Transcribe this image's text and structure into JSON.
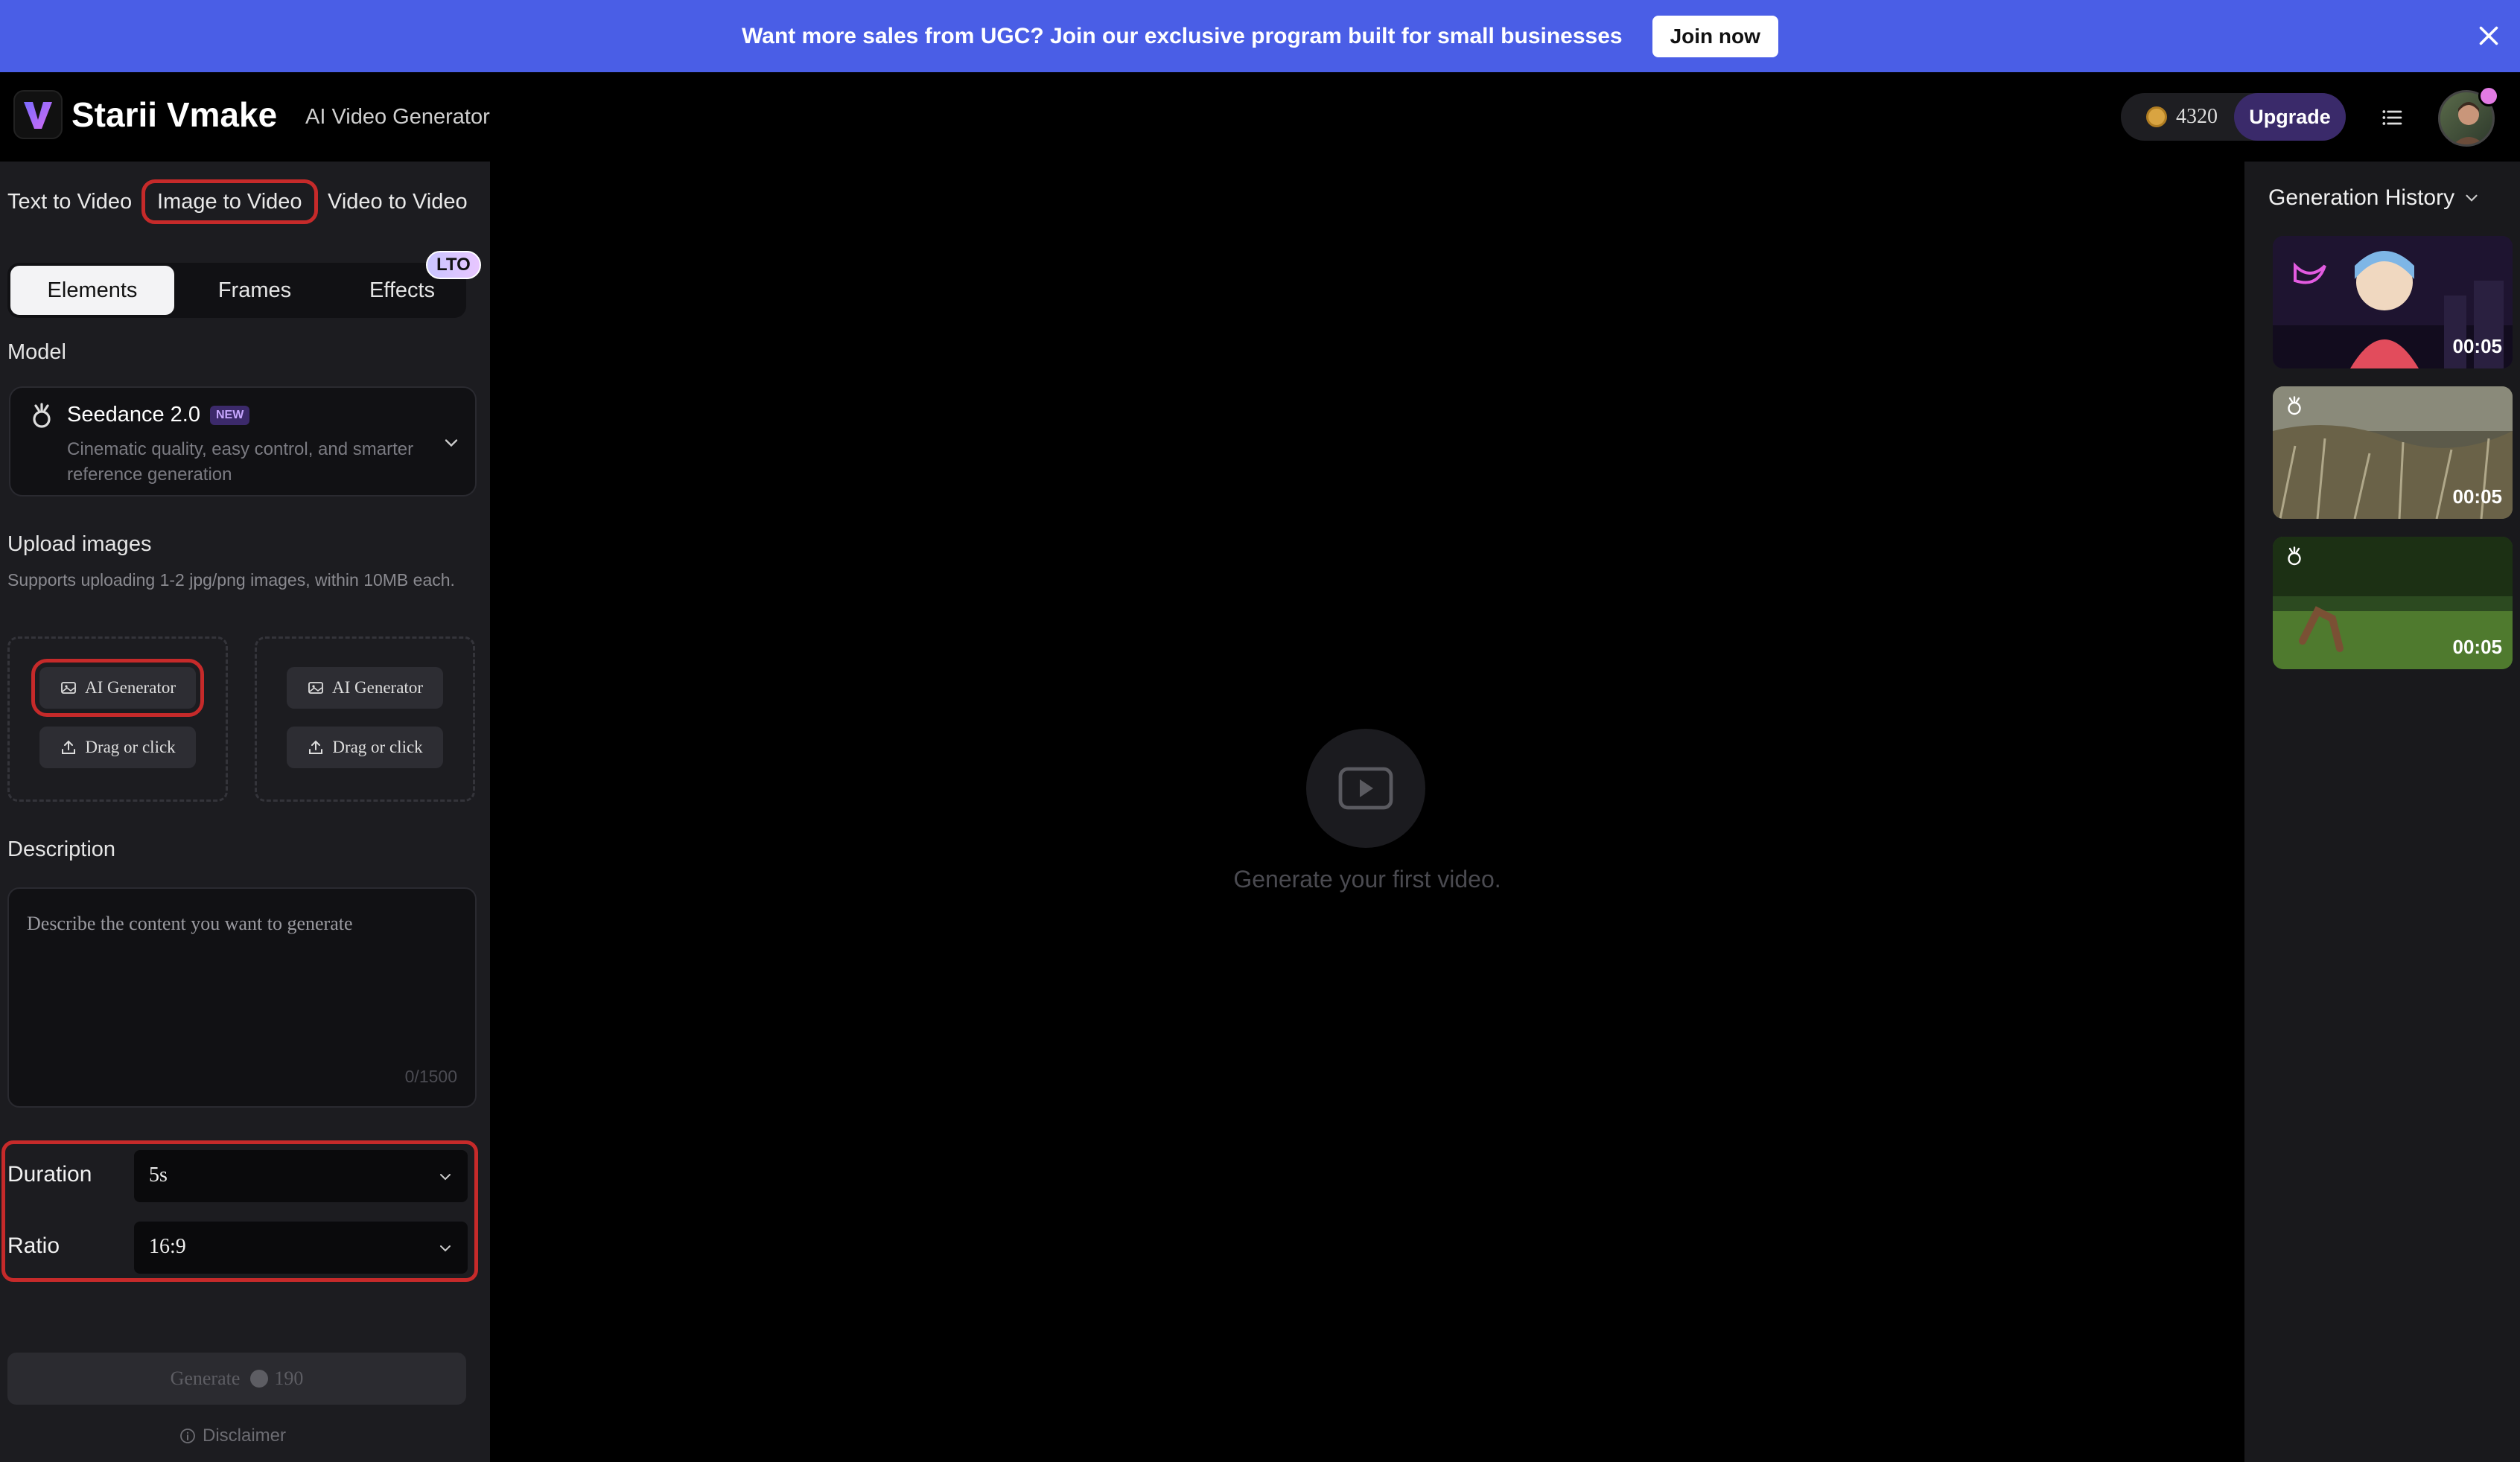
{
  "banner": {
    "text": "Want more sales from UGC? Join our exclusive program built for small businesses",
    "cta": "Join now",
    "close_icon": "close-icon"
  },
  "header": {
    "brand": "Starii Vmake",
    "subtitle": "AI Video Generator",
    "credits": "4320",
    "upgrade": "Upgrade",
    "menu_icon": "list-icon"
  },
  "left": {
    "mode_tabs": [
      "Text to Video",
      "Image to Video",
      "Video to Video"
    ],
    "active_mode": "Image to Video",
    "segments": [
      "Elements",
      "Frames",
      "Effects"
    ],
    "active_segment": "Elements",
    "lto_badge": "LTO",
    "model_label": "Model",
    "model": {
      "name": "Seedance 2.0",
      "badge": "NEW",
      "description": "Cinematic quality, easy control, and smarter reference generation"
    },
    "upload": {
      "title": "Upload images",
      "subtitle": "Supports uploading 1-2 jpg/png images, within 10MB each.",
      "ai_generator": "AI Generator",
      "drag": "Drag or click"
    },
    "description": {
      "title": "Description",
      "placeholder": "Describe the content you want to generate",
      "count": "0/1500"
    },
    "duration": {
      "label": "Duration",
      "value": "5s"
    },
    "ratio": {
      "label": "Ratio",
      "value": "16:9"
    },
    "generate": {
      "label": "Generate",
      "cost": "190"
    },
    "disclaimer": "Disclaimer"
  },
  "center": {
    "empty_text": "Generate your first video."
  },
  "history": {
    "title": "Generation History",
    "items": [
      {
        "duration": "00:05"
      },
      {
        "duration": "00:05"
      },
      {
        "duration": "00:05"
      }
    ]
  },
  "colors": {
    "banner": "#4a5ee6",
    "highlight": "#c62a2a",
    "upgrade": "#3a2a6a"
  }
}
